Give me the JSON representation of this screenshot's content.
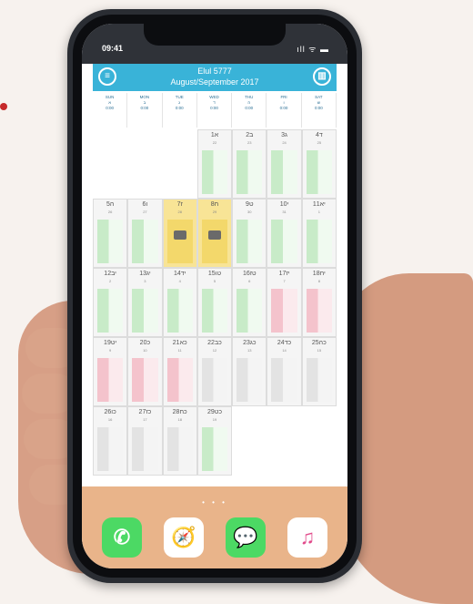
{
  "status": {
    "time": "09:41",
    "icons": "ıll ᯤ ▬"
  },
  "header": {
    "menu_icon": "≡",
    "title_line1": "Elul 5777",
    "title_line2": "August/September 2017",
    "right_icon": "▥"
  },
  "dow": [
    {
      "en": "SUN",
      "he": "א",
      "t": "0:00"
    },
    {
      "en": "MON",
      "he": "ב",
      "t": "0:00"
    },
    {
      "en": "TUE",
      "he": "ג",
      "t": "0:00"
    },
    {
      "en": "WED",
      "he": "ד",
      "t": "0:00"
    },
    {
      "en": "THU",
      "he": "ה",
      "t": "0:00"
    },
    {
      "en": "FRI",
      "he": "ו",
      "t": "0:00"
    },
    {
      "en": "SAT",
      "he": "ש",
      "t": "0:00"
    }
  ],
  "days": [
    {
      "n": "",
      "s": "",
      "c": "empty"
    },
    {
      "n": "",
      "s": "",
      "c": "empty"
    },
    {
      "n": "",
      "s": "",
      "c": "empty"
    },
    {
      "n": "1א",
      "s": "22",
      "c": "green"
    },
    {
      "n": "2ב",
      "s": "23",
      "c": "green"
    },
    {
      "n": "3ג",
      "s": "24",
      "c": "green"
    },
    {
      "n": "4ד",
      "s": "25",
      "c": "green"
    },
    {
      "n": "5ה",
      "s": "26",
      "c": "green"
    },
    {
      "n": "6ו",
      "s": "27",
      "c": "green"
    },
    {
      "n": "7ז",
      "s": "28",
      "c": "yellow"
    },
    {
      "n": "8ח",
      "s": "29",
      "c": "yellow"
    },
    {
      "n": "9ט",
      "s": "30",
      "c": "green"
    },
    {
      "n": "10י",
      "s": "31",
      "c": "green"
    },
    {
      "n": "11יא",
      "s": "1",
      "c": "green"
    },
    {
      "n": "12יב",
      "s": "2",
      "c": "green"
    },
    {
      "n": "13יג",
      "s": "3",
      "c": "green"
    },
    {
      "n": "14יד",
      "s": "4",
      "c": "green"
    },
    {
      "n": "15טו",
      "s": "5",
      "c": "green"
    },
    {
      "n": "16טז",
      "s": "6",
      "c": "green"
    },
    {
      "n": "17יז",
      "s": "7",
      "c": "pink"
    },
    {
      "n": "18יח",
      "s": "8",
      "c": "pink"
    },
    {
      "n": "19יט",
      "s": "9",
      "c": "pink"
    },
    {
      "n": "20כ",
      "s": "10",
      "c": "pink"
    },
    {
      "n": "21כא",
      "s": "11",
      "c": "pink"
    },
    {
      "n": "22כב",
      "s": "12",
      "c": "gray"
    },
    {
      "n": "23כג",
      "s": "13",
      "c": "gray"
    },
    {
      "n": "24כד",
      "s": "14",
      "c": "gray"
    },
    {
      "n": "25כה",
      "s": "15",
      "c": "gray"
    },
    {
      "n": "26כו",
      "s": "16",
      "c": "gray"
    },
    {
      "n": "27כז",
      "s": "17",
      "c": "gray"
    },
    {
      "n": "28כח",
      "s": "18",
      "c": "gray"
    },
    {
      "n": "29כט",
      "s": "19",
      "c": "green"
    }
  ],
  "dock": {
    "page_dots": "• • •",
    "apps": [
      {
        "name": "phone",
        "glyph": "✆"
      },
      {
        "name": "safari",
        "glyph": "🧭"
      },
      {
        "name": "messages",
        "glyph": "💬"
      },
      {
        "name": "music",
        "glyph": "♫"
      }
    ]
  }
}
